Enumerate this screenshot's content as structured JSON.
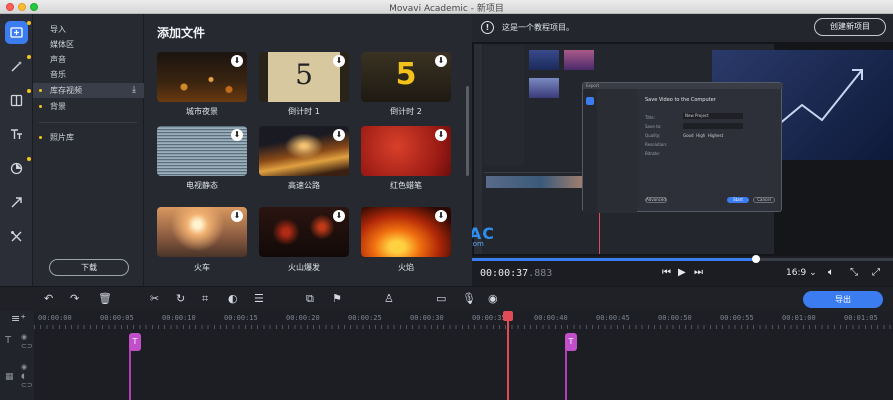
{
  "window": {
    "title": "Movavi Academic - 新项目"
  },
  "sidebar_tools": [
    {
      "icon": "import-icon",
      "active": true
    },
    {
      "icon": "magic-wand-icon",
      "active": false
    },
    {
      "icon": "transitions-icon",
      "active": false
    },
    {
      "icon": "titles-icon",
      "active": false
    },
    {
      "icon": "stickers-icon",
      "active": false
    },
    {
      "icon": "callouts-icon",
      "active": false
    },
    {
      "icon": "tools-icon",
      "active": false
    }
  ],
  "categories": {
    "items": [
      "导入",
      "媒体区",
      "声音",
      "音乐",
      "库存视频",
      "背景"
    ],
    "selected": "库存视频",
    "photo_library": "照片库",
    "download_button": "下载"
  },
  "files": {
    "title": "添加文件",
    "items": [
      {
        "label": "城市夜景"
      },
      {
        "label": "倒计时 1",
        "digit": "5"
      },
      {
        "label": "倒计时 2",
        "digit": "5"
      },
      {
        "label": "电视静态"
      },
      {
        "label": "高速公路"
      },
      {
        "label": "红色蜡笔"
      },
      {
        "label": "火车"
      },
      {
        "label": "火山爆发"
      },
      {
        "label": "火焰"
      }
    ]
  },
  "preview": {
    "notice": "这是一个教程项目。",
    "create_button": "创建新项目",
    "watermark_main": "我爱MAC",
    "watermark_sub": "www.52mac.com",
    "progress": 0.675,
    "timecode_main": "00:00:37",
    "timecode_ms": ".883",
    "aspect_ratio": "16:9"
  },
  "inner_dialog": {
    "title": "Save Video to the Computer",
    "fields": [
      "Title:",
      "Save to:",
      "Quality:",
      "Resolution:",
      "Bitrate:"
    ],
    "title_value": "New Project",
    "quality_options": [
      "Good",
      "High",
      "Highest"
    ],
    "advanced": "Advanced",
    "start": "Start",
    "cancel": "Cancel",
    "header": "Export"
  },
  "toolbar": {
    "export_button": "导出"
  },
  "timeline": {
    "ticks": [
      "00:00:00",
      "00:00:05",
      "00:00:10",
      "00:00:15",
      "00:00:20",
      "00:00:25",
      "00:00:30",
      "00:00:35",
      "00:00:40",
      "00:00:45",
      "00:00:50",
      "00:00:55",
      "00:01:00",
      "00:01:05"
    ],
    "clip_label": "T"
  },
  "colors": {
    "accent": "#3b7cf0",
    "playhead": "#e24b55",
    "clip": "#c24fca"
  }
}
